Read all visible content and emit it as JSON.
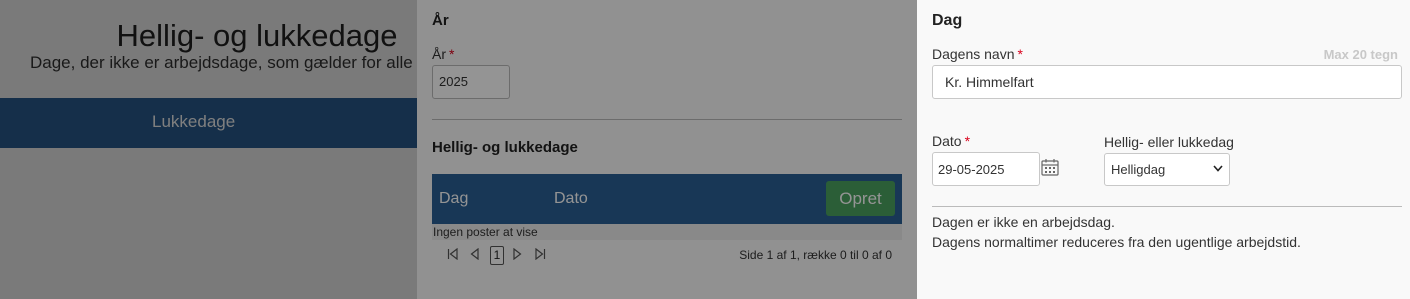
{
  "background": {
    "title": "Hellig- og lukkedage",
    "subtitle": "Dage, der ikke er arbejdsdage, som gælder for alle u",
    "tab": "Lukkedage"
  },
  "middle": {
    "year_heading": "År",
    "year_label": "År",
    "year_value": "2025",
    "list_heading": "Hellig- og lukkedage",
    "columns": [
      "Dag",
      "Dato"
    ],
    "create_button": "Opret",
    "empty_text": "Ingen poster at vise",
    "pager": {
      "current_page": "1",
      "info": "Side 1 af 1, række 0 til 0 af 0"
    }
  },
  "right": {
    "heading": "Dag",
    "name_label": "Dagens navn",
    "name_hint": "Max 20 tegn",
    "name_value": "Kr. Himmelfart",
    "date_label": "Dato",
    "date_value": "29-05-2025",
    "type_label": "Hellig- eller lukkedag",
    "type_value": "Helligdag",
    "info_line_1": "Dagen er ikke en arbejdsdag.",
    "info_line_2": "Dagens normaltimer reduceres fra den ugentlige arbejdstid."
  },
  "required_marker": "*",
  "colors": {
    "header_blue": "#2a5f94",
    "create_green": "#4aa35f",
    "required_red": "#d9001b"
  }
}
